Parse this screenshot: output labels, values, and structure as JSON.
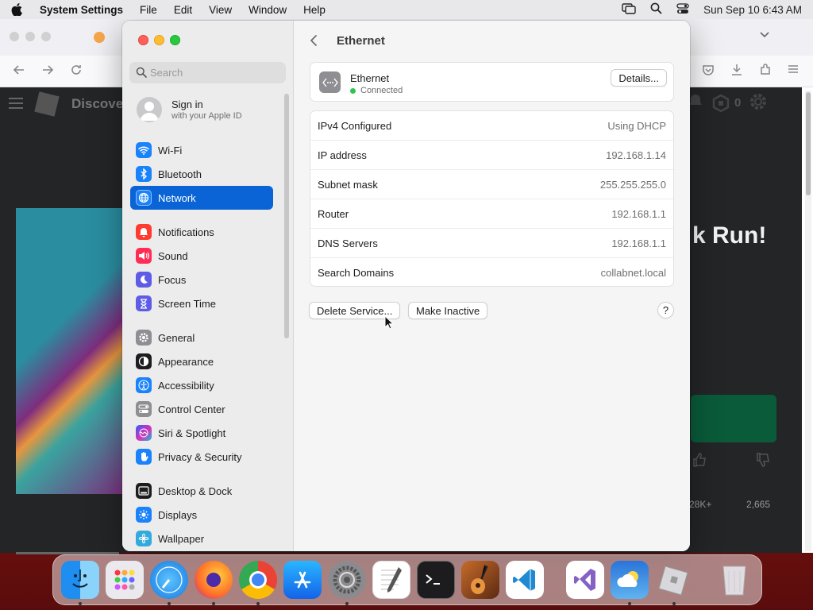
{
  "menubar": {
    "app_name": "System Settings",
    "menus": [
      "File",
      "Edit",
      "View",
      "Window",
      "Help"
    ],
    "clock": "Sun Sep 10  6:43 AM"
  },
  "background_browser": {
    "page_heading_fragment": "Discove",
    "big_text_fragment": "k Run!",
    "stat_left": "28K+",
    "stat_right": "2,665",
    "counter": "0"
  },
  "sidebar": {
    "search_placeholder": "Search",
    "signin_title": "Sign in",
    "signin_subtitle": "with your Apple ID",
    "items": [
      {
        "label": "Wi-Fi",
        "icon": "wifi-icon",
        "color": "#1a82fb"
      },
      {
        "label": "Bluetooth",
        "icon": "bluetooth-icon",
        "color": "#1a82fb"
      },
      {
        "label": "Network",
        "icon": "globe-icon",
        "color": "#1a82fb",
        "active": true
      },
      {
        "label": "Notifications",
        "icon": "bell-icon",
        "color": "#ff3b30"
      },
      {
        "label": "Sound",
        "icon": "speaker-icon",
        "color": "#ff2d55"
      },
      {
        "label": "Focus",
        "icon": "moon-icon",
        "color": "#5e5ce6"
      },
      {
        "label": "Screen Time",
        "icon": "hourglass-icon",
        "color": "#5e5ce6"
      },
      {
        "label": "General",
        "icon": "gear-icon",
        "color": "#8e8e93"
      },
      {
        "label": "Appearance",
        "icon": "appearance-icon",
        "color": "#1d1d1f"
      },
      {
        "label": "Accessibility",
        "icon": "accessibility-icon",
        "color": "#1a82fb"
      },
      {
        "label": "Control Center",
        "icon": "control-center-icon",
        "color": "#8e8e93"
      },
      {
        "label": "Siri & Spotlight",
        "icon": "siri-icon",
        "color": "#c03ce0"
      },
      {
        "label": "Privacy & Security",
        "icon": "hand-icon",
        "color": "#1a82fb"
      },
      {
        "label": "Desktop & Dock",
        "icon": "dock-icon",
        "color": "#1d1d1f"
      },
      {
        "label": "Displays",
        "icon": "sun-icon",
        "color": "#1a82fb"
      },
      {
        "label": "Wallpaper",
        "icon": "wallpaper-icon",
        "color": "#34aadc"
      }
    ]
  },
  "pane": {
    "title": "Ethernet",
    "service_name": "Ethernet",
    "service_status": "Connected",
    "details_label": "Details...",
    "rows": [
      {
        "key": "IPv4 Configured",
        "value": "Using DHCP"
      },
      {
        "key": "IP address",
        "value": "192.168.1.14"
      },
      {
        "key": "Subnet mask",
        "value": "255.255.255.0"
      },
      {
        "key": "Router",
        "value": "192.168.1.1"
      },
      {
        "key": "DNS Servers",
        "value": "192.168.1.1"
      },
      {
        "key": "Search Domains",
        "value": "collabnet.local"
      }
    ],
    "delete_label": "Delete Service...",
    "inactive_label": "Make Inactive",
    "help_label": "?"
  },
  "dock": {
    "apps": [
      "Finder",
      "Launchpad",
      "Safari",
      "Firefox",
      "Chrome",
      "App Store",
      "System Settings",
      "TextEdit",
      "Terminal",
      "GarageBand",
      "Visual Studio Code",
      "Visual Studio",
      "Weather",
      "Roblox",
      "Trash"
    ]
  }
}
